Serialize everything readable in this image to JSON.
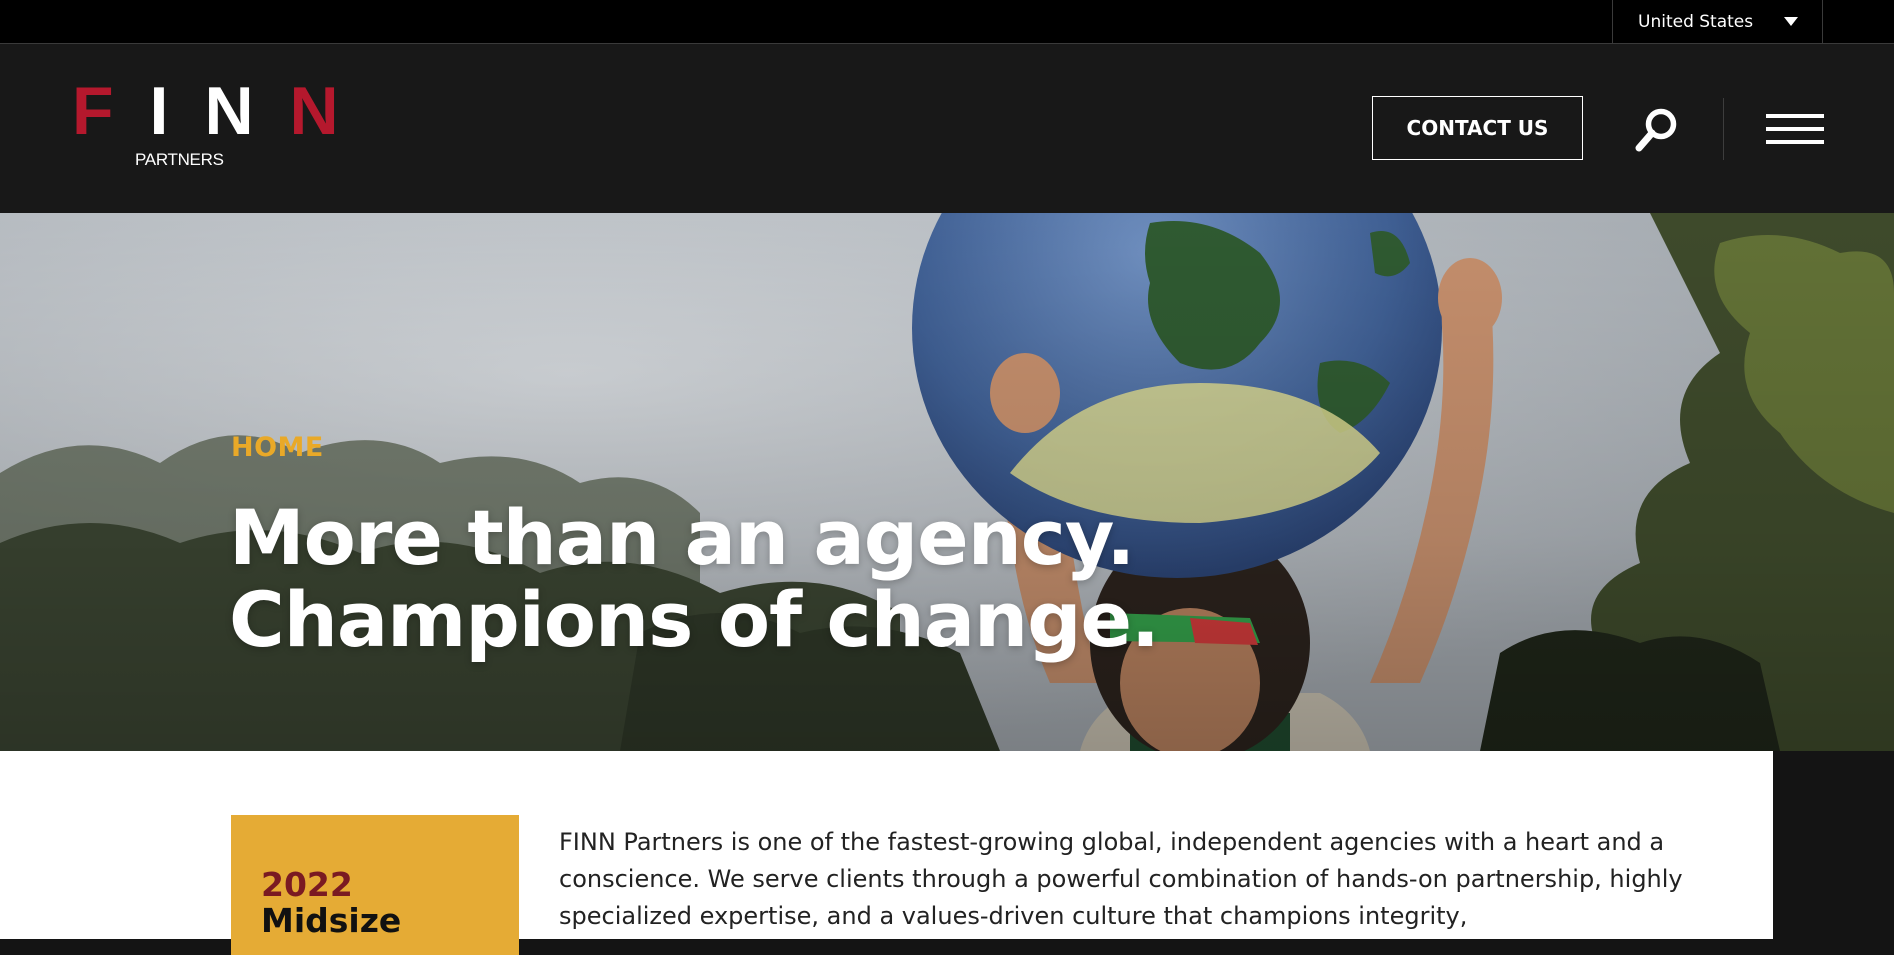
{
  "region_selector": {
    "label": "United States"
  },
  "header": {
    "logo": {
      "word_left": "F",
      "word_mid": "IN",
      "word_right": "N",
      "sub": "PARTNERS"
    },
    "contact_label": "CONTACT US"
  },
  "hero": {
    "breadcrumb": "HOME",
    "title_line1": "More than an agency.",
    "title_line2": "Champions of change."
  },
  "award": {
    "year": "2022",
    "title": "Midsize"
  },
  "intro": {
    "text": "FINN Partners is one of the fastest-growing global, independent agencies with a heart and a conscience. We serve clients through a powerful combination of hands-on partnership, highly specialized expertise, and a values-driven culture that champions integrity,"
  },
  "colors": {
    "brand_red": "#b5182d",
    "accent_gold": "#e9a928",
    "award_bg": "#e5ab35",
    "header_bg": "#181818"
  },
  "icons": {
    "search": "search-icon",
    "menu": "hamburger-menu-icon",
    "region_caret": "caret-down-icon"
  }
}
